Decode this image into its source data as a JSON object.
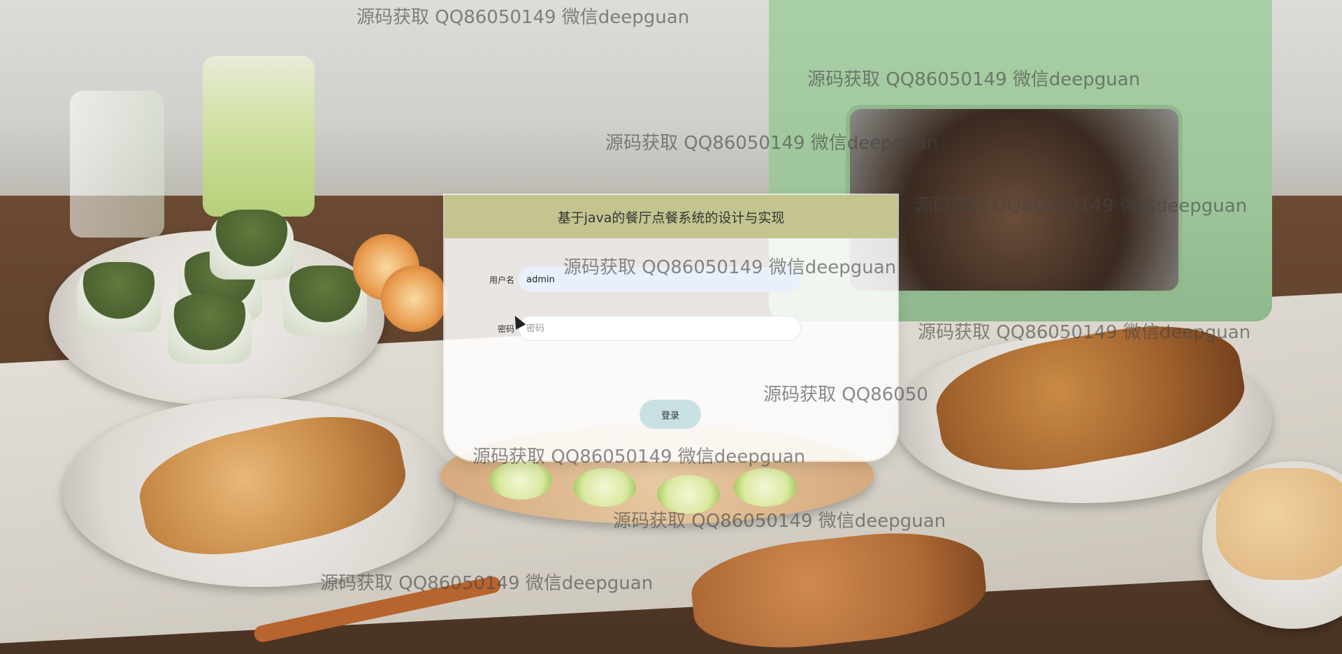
{
  "login": {
    "title": "基于java的餐厅点餐系统的设计与实现",
    "username_label": "用户名",
    "username_value": "admin",
    "password_label": "密码",
    "password_placeholder": "密码",
    "login_button": "登录"
  },
  "watermark": {
    "text": "源码获取 QQ86050149 微信deepguan",
    "partial_1": "源码获取 QQ86050149 微信deepguan",
    "partial_2": "源码获取 QQ86050",
    "count": 10
  },
  "colors": {
    "header_bg": "#c4c48f",
    "button_bg": "#c9e1e3",
    "username_field_bg": "#e8f0fb",
    "card_bg": "#ffffff"
  }
}
